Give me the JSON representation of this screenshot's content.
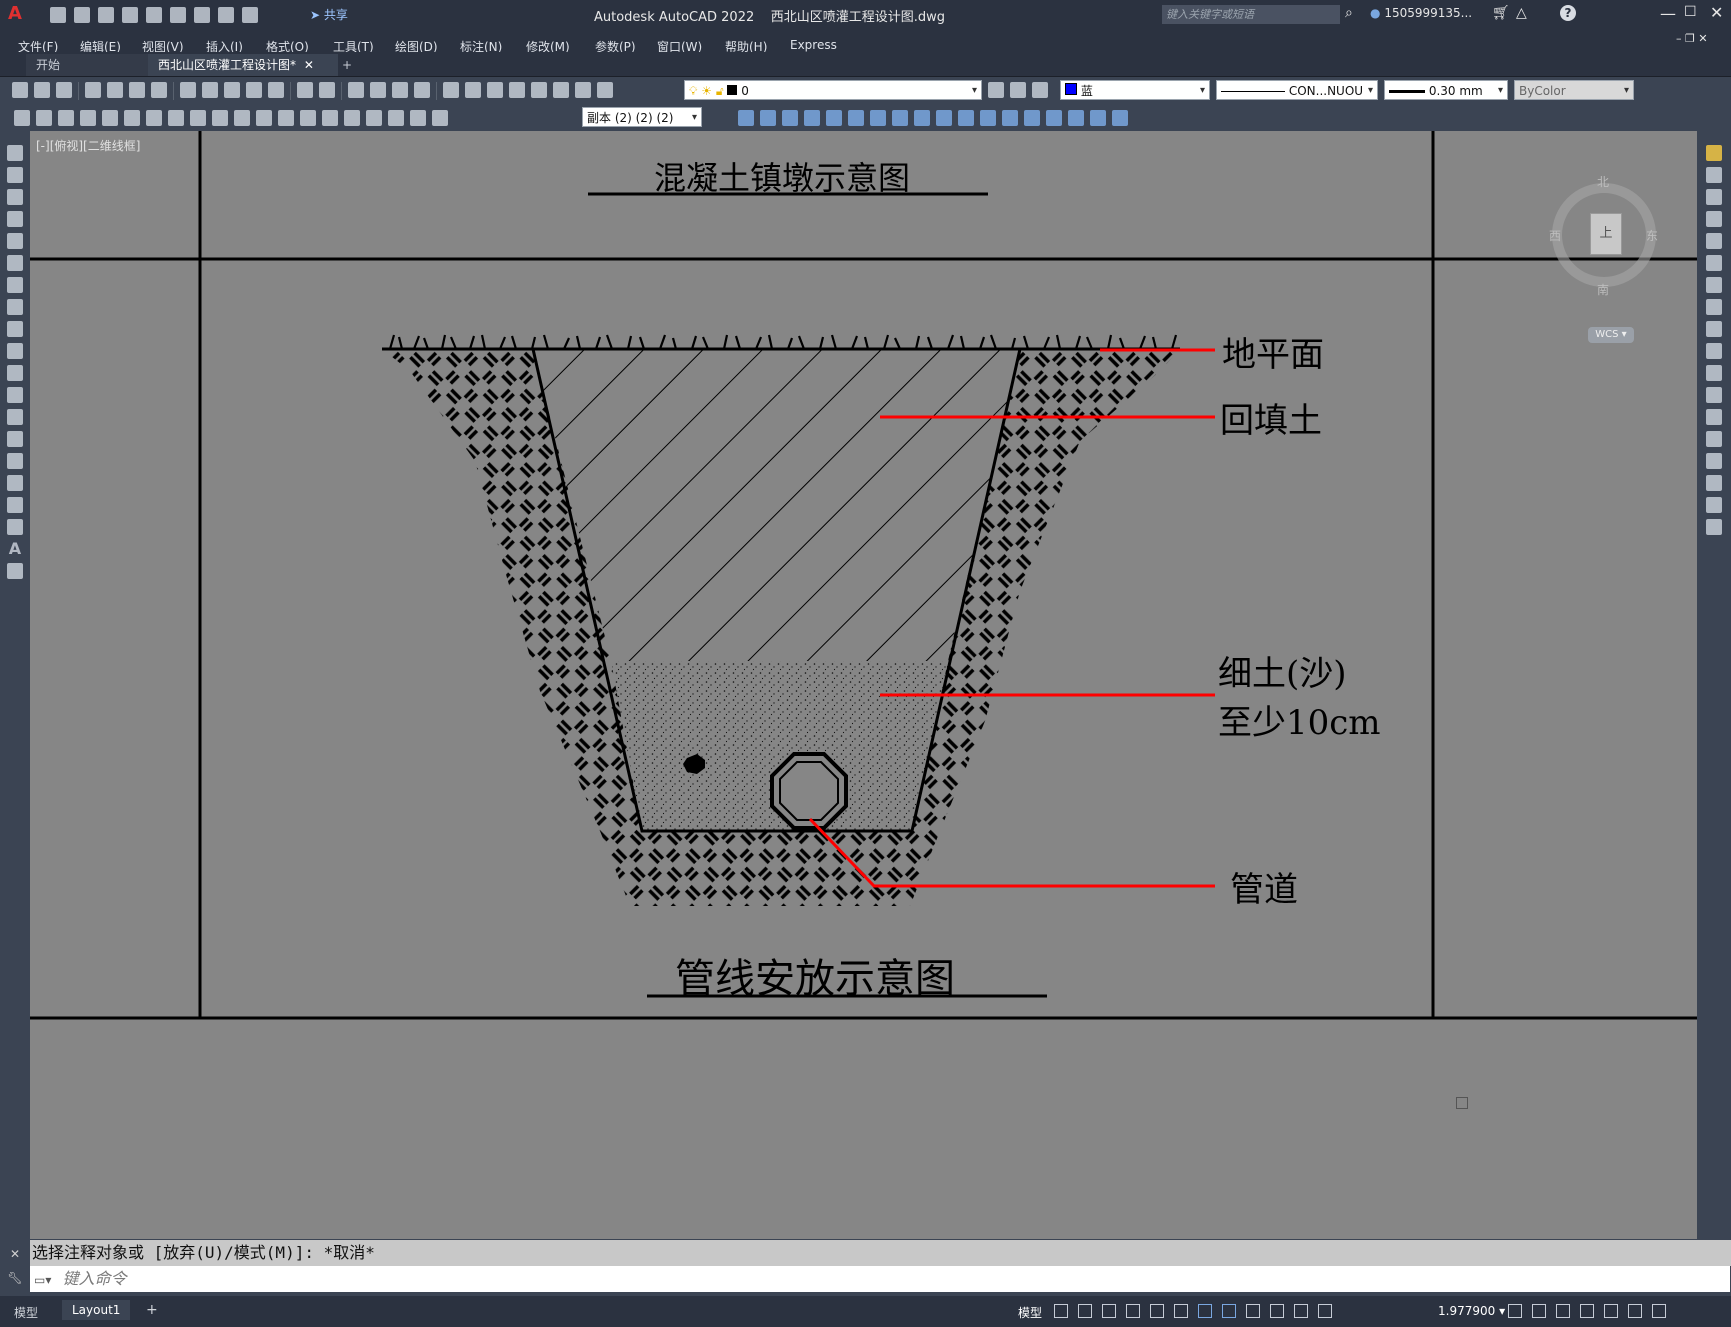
{
  "app": {
    "title": "Autodesk AutoCAD 2022    西北山区喷灌工程设计图.dwg",
    "search_placeholder": "键入关键字或短语",
    "user": "1505999135...",
    "share": "共享"
  },
  "menu": [
    "文件(F)",
    "编辑(E)",
    "视图(V)",
    "插入(I)",
    "格式(O)",
    "工具(T)",
    "绘图(D)",
    "标注(N)",
    "修改(M)",
    "参数(P)",
    "窗口(W)",
    "帮助(H)",
    "Express"
  ],
  "tabs": {
    "start": "开始",
    "active": "西北山区喷灌工程设计图*",
    "add": "+"
  },
  "properties": {
    "layer": "0",
    "color": "蓝",
    "linetype": "CON...NUOU",
    "lineweight": "0.30 mm",
    "plotstyle": "ByColor",
    "dimstyle": "副本 (2) (2) (2)"
  },
  "viewport_label": "[-][俯视][二维线框]",
  "viewcube": {
    "north": "北",
    "south": "南",
    "east": "东",
    "west": "西",
    "face": "上",
    "wcs": "WCS"
  },
  "drawing": {
    "title_top": "混凝土镇墩示意图",
    "title_bottom": "管线安放示意图",
    "labels": {
      "ground": "地平面",
      "backfill": "回填土",
      "fine_soil_1": "细土(沙)",
      "fine_soil_2": "至少10cm",
      "pipe": "管道"
    },
    "colors": {
      "leader": "#ff0000",
      "ink": "#000000",
      "paper": "#868686"
    }
  },
  "command": {
    "history": "选择注释对象或 [放弃(U)/模式(M)]: *取消*",
    "placeholder": "键入命令"
  },
  "layout_tabs": {
    "model": "模型",
    "layout1": "Layout1",
    "add": "+"
  },
  "status": {
    "model": "模型",
    "scale": "1.977900"
  }
}
